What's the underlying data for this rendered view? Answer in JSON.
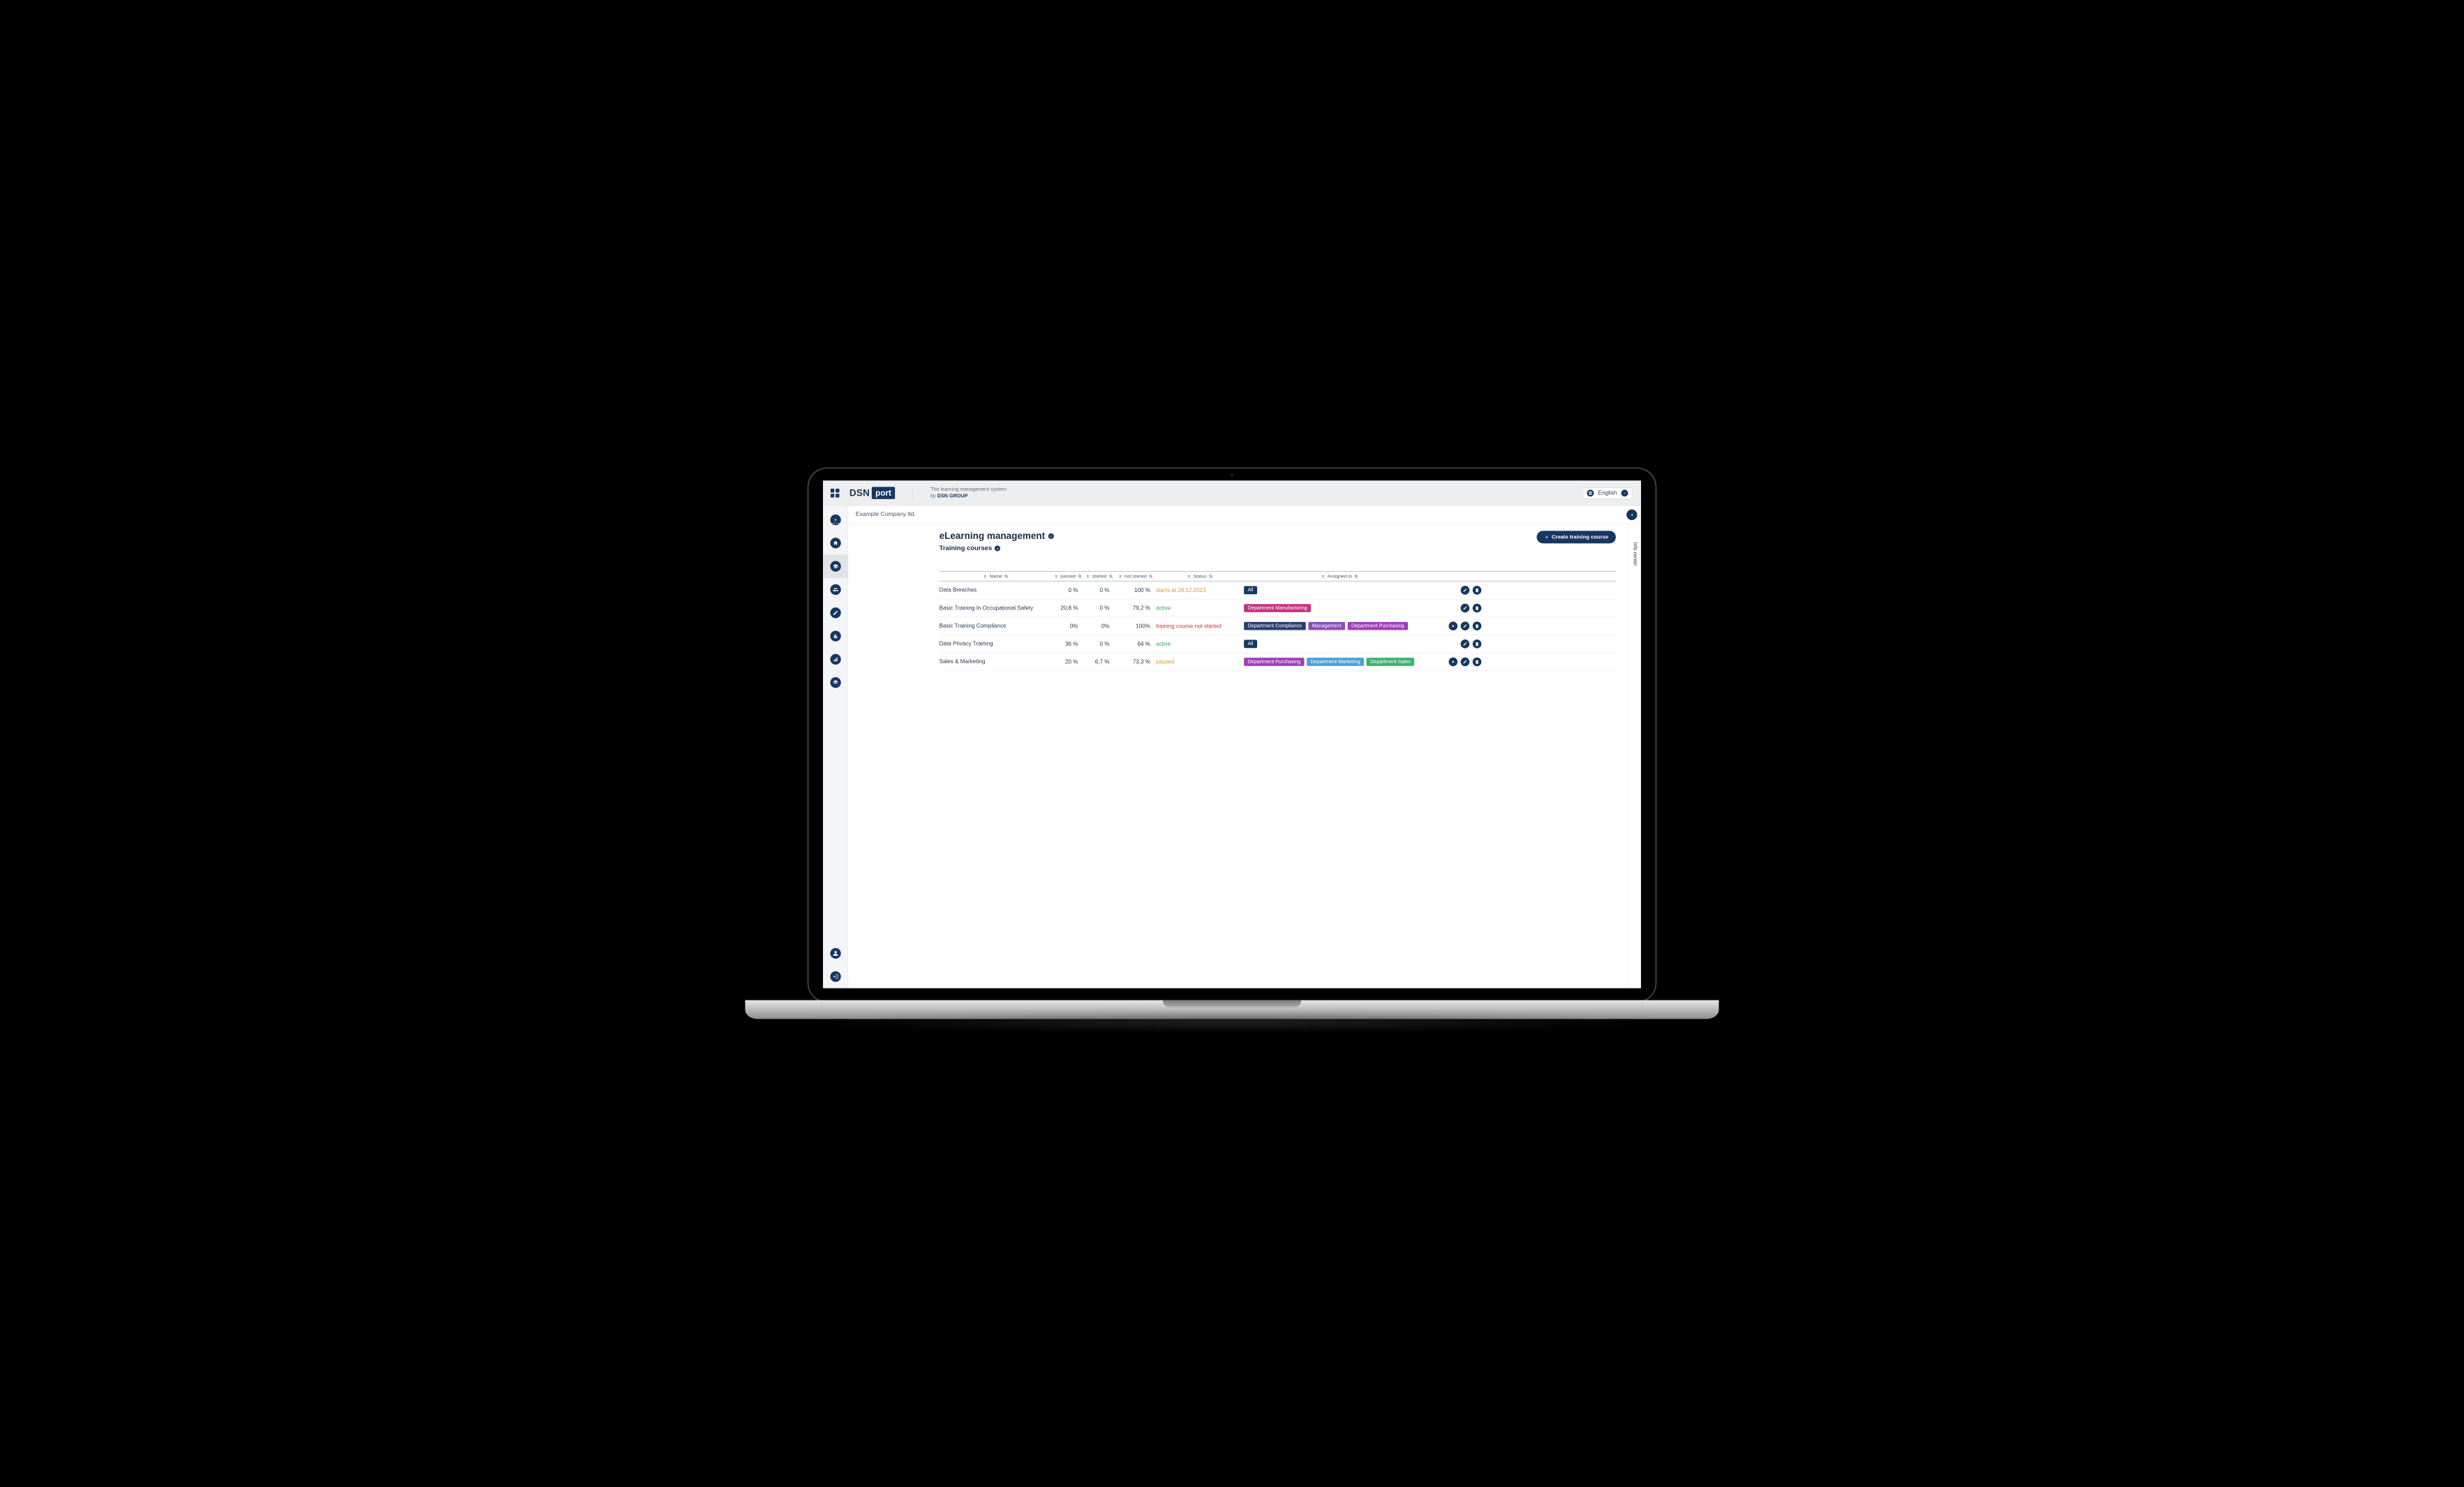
{
  "brand": {
    "left": "DSN",
    "right": "port"
  },
  "tagline": {
    "line1": "The learning management system",
    "by": "by ",
    "group": "DSN GROUP"
  },
  "language": {
    "label": "English"
  },
  "breadcrumb": "Example Company ltd.",
  "info_center_label": "Info center",
  "page": {
    "title": "eLearning management",
    "subtitle": "Training courses",
    "create_btn": "Create training course"
  },
  "columns": {
    "name": "Name",
    "passed": "passed",
    "started": "started",
    "not_started": "not started",
    "status": "Status",
    "assigned": "Assigned to"
  },
  "rows": [
    {
      "name": "Data Breaches",
      "passed": "0 %",
      "started": "0 %",
      "not_started": "100 %",
      "status": {
        "text": "starts at 28.12.2023",
        "cls": "st-orange"
      },
      "tags": [
        {
          "label": "All",
          "cls": "tag-all"
        }
      ],
      "actions": [
        "edit",
        "delete"
      ]
    },
    {
      "name": "Basic Training In Occupational Safety",
      "passed": "20,8 %",
      "started": "0 %",
      "not_started": "79,2 %",
      "status": {
        "text": "active",
        "cls": "st-green"
      },
      "tags": [
        {
          "label": "Department Manufactoring",
          "cls": "tag-pink"
        }
      ],
      "actions": [
        "edit",
        "delete"
      ]
    },
    {
      "name": "Basic Training Compliance",
      "passed": "0%",
      "started": "0%",
      "not_started": "100%",
      "status": {
        "text": "training course not started",
        "cls": "st-red"
      },
      "tags": [
        {
          "label": "Department Compliance",
          "cls": "tag-navy"
        },
        {
          "label": "Management",
          "cls": "tag-purple"
        },
        {
          "label": "Department Purchasing",
          "cls": "tag-magenta"
        }
      ],
      "actions": [
        "play",
        "edit",
        "delete"
      ]
    },
    {
      "name": "Data Privacy Training",
      "passed": "36 %",
      "started": "0 %",
      "not_started": "64 %",
      "status": {
        "text": "active",
        "cls": "st-green"
      },
      "tags": [
        {
          "label": "All",
          "cls": "tag-all"
        }
      ],
      "actions": [
        "edit",
        "delete"
      ]
    },
    {
      "name": "Sales & Marketing",
      "passed": "20 %",
      "started": "6,7 %",
      "not_started": "73,3 %",
      "status": {
        "text": "paused",
        "cls": "st-orange"
      },
      "tags": [
        {
          "label": "Department Purchasing",
          "cls": "tag-magenta"
        },
        {
          "label": "Department Marketing",
          "cls": "tag-blue"
        },
        {
          "label": "Department Sales",
          "cls": "tag-green"
        }
      ],
      "actions": [
        "play",
        "edit",
        "delete"
      ]
    }
  ]
}
